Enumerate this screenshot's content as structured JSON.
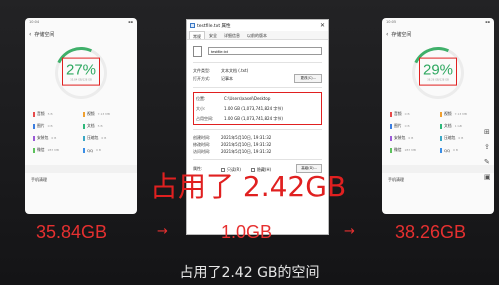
{
  "left_phone": {
    "status_time": "10:04",
    "title": "存储空间",
    "percent": "27%",
    "ring_sub": "35.84 GB/128 GB",
    "legend": [
      {
        "label": "音频",
        "size": "5 B",
        "color": "#e64a4a"
      },
      {
        "label": "视频",
        "size": "7.13 MB",
        "color": "#f0a030"
      },
      {
        "label": "图片",
        "size": "0 B",
        "color": "#3a7de0"
      },
      {
        "label": "文档",
        "size": "5 B",
        "color": "#2eb87a"
      },
      {
        "label": "安装包",
        "size": "0 B",
        "color": "#9a5ad6"
      },
      {
        "label": "压缩包",
        "size": "0 B",
        "color": "#3aa7c4"
      },
      {
        "label": "微信",
        "size": "287 MB",
        "color": "#5cc15c"
      },
      {
        "label": "QQ",
        "size": "0 B",
        "color": "#3a8ee6"
      }
    ],
    "row": "手机清理"
  },
  "right_phone": {
    "status_time": "10:05",
    "title": "存储空间",
    "percent": "29%",
    "ring_sub": "38.26 GB/128 GB",
    "legend": [
      {
        "label": "音频",
        "size": "0 B",
        "color": "#e64a4a"
      },
      {
        "label": "视频",
        "size": "7.13 MB",
        "color": "#f0a030"
      },
      {
        "label": "图片",
        "size": "0 B",
        "color": "#3a7de0"
      },
      {
        "label": "文档",
        "size": "1 GB",
        "color": "#2eb87a"
      },
      {
        "label": "安装包",
        "size": "0 B",
        "color": "#9a5ad6"
      },
      {
        "label": "压缩包",
        "size": "0 B",
        "color": "#3aa7c4"
      },
      {
        "label": "微信",
        "size": "287 MB",
        "color": "#5cc15c"
      },
      {
        "label": "QQ",
        "size": "0 B",
        "color": "#3a8ee6"
      }
    ],
    "row": "手机清理"
  },
  "dialog": {
    "title": "testfile.txt 属性",
    "close": "✕",
    "tabs": [
      "常规",
      "安全",
      "详细信息",
      "以前的版本"
    ],
    "file_name": "testfile.txt",
    "type_label": "文件类型:",
    "type_value": "文本文档 (.txt)",
    "open_label": "打开方式:",
    "open_value": "记事本",
    "change_btn": "更改(C)...",
    "location_label": "位置:",
    "location_value": "C:\\Users\\xasel\\Desktop",
    "size_label": "大小:",
    "size_value": "1.00 GB (1,073,741,824 字节)",
    "disk_label": "占用空间:",
    "disk_value": "1.00 GB (1,073,741,824 字节)",
    "created_label": "创建时间:",
    "created_value": "2021年5月10日, 19:31:32",
    "modified_label": "修改时间:",
    "modified_value": "2021年5月10日, 19:31:32",
    "accessed_label": "访问时间:",
    "accessed_value": "2021年5月10日, 19:31:32",
    "attr_label": "属性:",
    "readonly": "只读(R)",
    "hidden": "隐藏(H)",
    "advanced_btn": "高级(D)..."
  },
  "overlay": {
    "headline": "占用了 2.42GB",
    "left_gb": "35.84GB",
    "mid_gb": "1.0GB",
    "right_gb": "38.26GB",
    "arrow": "→",
    "subtitle": "占用了2.42 GB的空间"
  },
  "colors": {
    "accent_red": "#e02020",
    "ring_green": "#2ea860"
  }
}
